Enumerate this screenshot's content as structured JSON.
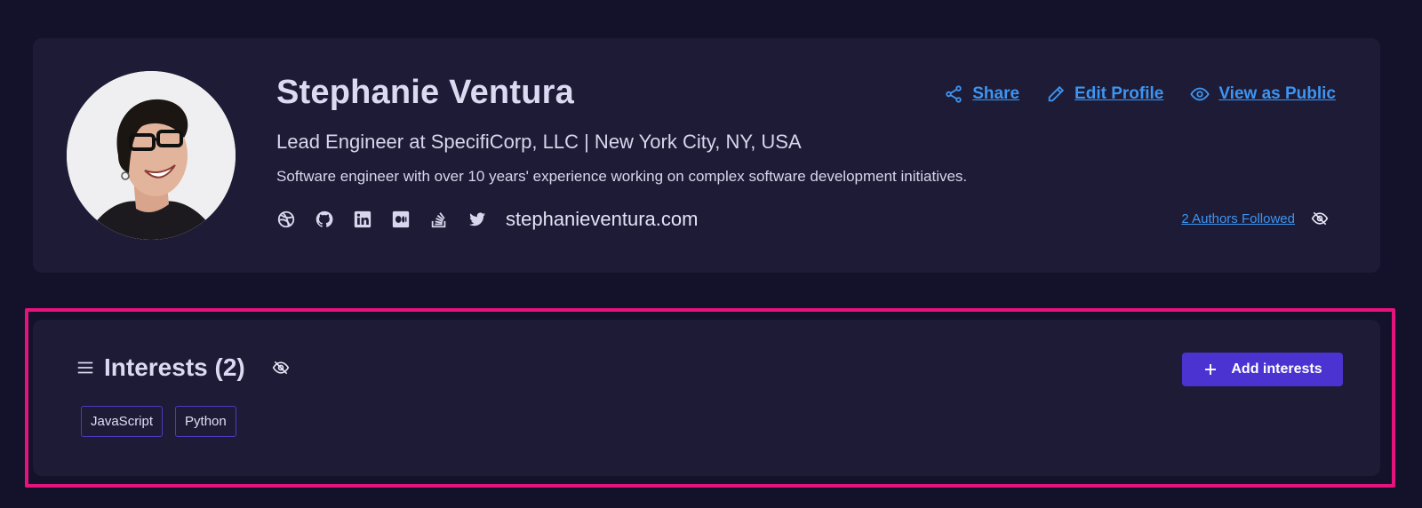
{
  "profile": {
    "name": "Stephanie Ventura",
    "headline": "Lead Engineer at SpecifiCorp, LLC | New York City, NY, USA",
    "bio": "Software engineer with over 10 years' experience working on complex software development initiatives.",
    "website": "stephanieventura.com",
    "social_icons": [
      "dribbble-icon",
      "github-icon",
      "linkedin-icon",
      "medium-icon",
      "stackoverflow-icon",
      "twitter-icon"
    ],
    "actions": {
      "share": "Share",
      "edit": "Edit Profile",
      "view_public": "View as Public"
    },
    "authors_followed": "2 Authors Followed"
  },
  "interests": {
    "title": "Interests (2)",
    "add_label": "Add interests",
    "tags": [
      "JavaScript",
      "Python"
    ]
  },
  "colors": {
    "background": "#14122a",
    "card": "#1d1b35",
    "link": "#3d95f2",
    "primary_button": "#4b33d1",
    "highlight": "#e5147d"
  }
}
